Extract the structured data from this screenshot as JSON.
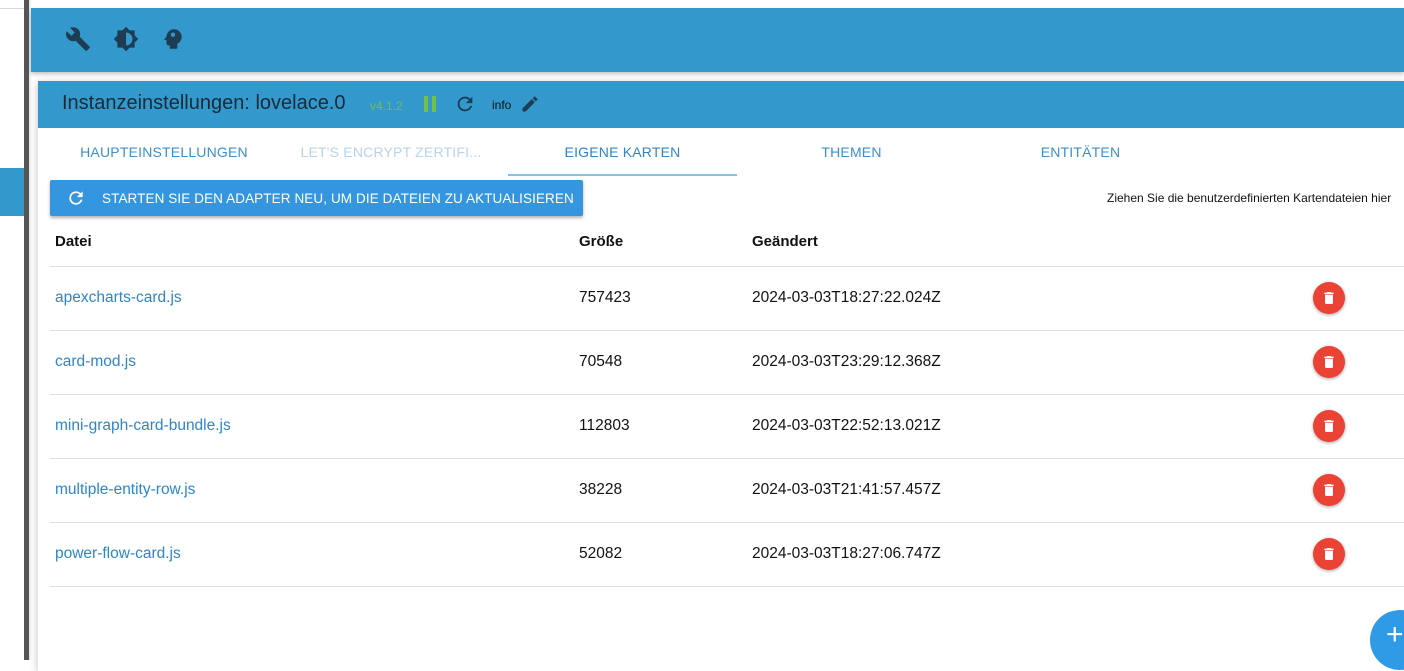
{
  "dialog": {
    "title": "Instanzeinstellungen: lovelace.0",
    "version": "v4.1.2",
    "info_label": "info"
  },
  "tabs": [
    {
      "label": "HAUPTEINSTELLUNGEN",
      "state": "normal"
    },
    {
      "label": "LET'S ENCRYPT ZERTIFI...",
      "state": "disabled"
    },
    {
      "label": "EIGENE KARTEN",
      "state": "active"
    },
    {
      "label": "THEMEN",
      "state": "normal"
    },
    {
      "label": "ENTITÄTEN",
      "state": "normal"
    }
  ],
  "restart_button": {
    "label": "STARTEN SIE DEN ADAPTER NEU, UM DIE DATEIEN ZU AKTUALISIEREN",
    "icon": "refresh-icon"
  },
  "drop_hint": "Ziehen Sie die benutzerdefinierten Kartendateien hier",
  "table": {
    "headers": {
      "file": "Datei",
      "size": "Größe",
      "changed": "Geändert"
    },
    "rows": [
      {
        "file": "apexcharts-card.js",
        "size": "757423",
        "changed": "2024-03-03T18:27:22.024Z"
      },
      {
        "file": "card-mod.js",
        "size": "70548",
        "changed": "2024-03-03T23:29:12.368Z"
      },
      {
        "file": "mini-graph-card-bundle.js",
        "size": "112803",
        "changed": "2024-03-03T22:52:13.021Z"
      },
      {
        "file": "multiple-entity-row.js",
        "size": "38228",
        "changed": "2024-03-03T21:41:57.457Z"
      },
      {
        "file": "power-flow-card.js",
        "size": "52082",
        "changed": "2024-03-03T18:27:06.747Z"
      }
    ]
  },
  "fab_label": "+",
  "colors": {
    "header_blue": "#3399cc",
    "button_blue": "#3596e0",
    "link_blue": "#2e86c9",
    "delete_red": "#ea4335",
    "running_green": "#6fc04a"
  },
  "icons": [
    "wrench-icon",
    "brightness-icon",
    "head-icon",
    "pause-icon",
    "refresh-icon",
    "pencil-icon",
    "trash-icon",
    "plus-icon"
  ]
}
